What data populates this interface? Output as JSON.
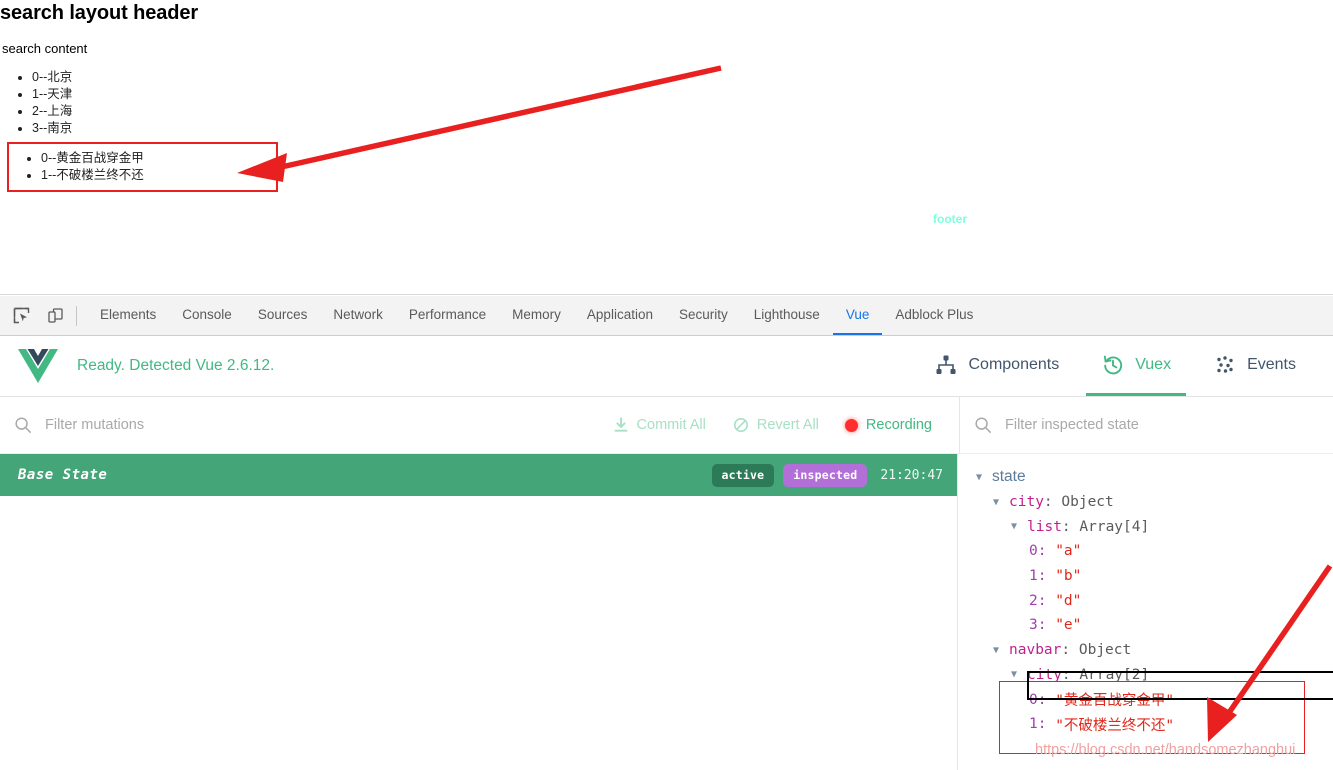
{
  "page": {
    "title": "search layout header",
    "subtitle": "search content",
    "city_list": [
      "0--北京",
      "1--天津",
      "2--上海",
      "3--南京"
    ],
    "navbar_list": [
      "0--黄金百战穿金甲",
      "1--不破楼兰终不还"
    ],
    "footer_label": "footer",
    "highlight_color": "#e8201f",
    "footer_color": "#7cffdd"
  },
  "devtools": {
    "left_icons": [
      "inspect-element-icon",
      "device-toolbar-icon"
    ],
    "tabs": [
      {
        "label": "Elements",
        "active": false
      },
      {
        "label": "Console",
        "active": false
      },
      {
        "label": "Sources",
        "active": false
      },
      {
        "label": "Network",
        "active": false
      },
      {
        "label": "Performance",
        "active": false
      },
      {
        "label": "Memory",
        "active": false
      },
      {
        "label": "Application",
        "active": false
      },
      {
        "label": "Security",
        "active": false
      },
      {
        "label": "Lighthouse",
        "active": false
      },
      {
        "label": "Vue",
        "active": true
      },
      {
        "label": "Adblock Plus",
        "active": false
      }
    ],
    "active_tab_color": "#1a73e8"
  },
  "vue_devtools": {
    "status_text": "Ready. Detected Vue 2.6.12.",
    "logo": "vue-logo-icon",
    "accent_color": "#42b883",
    "panel_tabs": [
      {
        "label": "Components",
        "icon": "components-tree-icon",
        "active": false
      },
      {
        "label": "Vuex",
        "icon": "vuex-history-icon",
        "active": true
      },
      {
        "label": "Events",
        "icon": "events-dots-icon",
        "active": false
      }
    ]
  },
  "mutations": {
    "filter_placeholder": "Filter mutations",
    "filter_value": "",
    "actions": [
      {
        "label": "Commit All",
        "icon": "download-icon",
        "enabled": false
      },
      {
        "label": "Revert All",
        "icon": "revert-circle-slash-icon",
        "enabled": false
      },
      {
        "label": "Recording",
        "icon": "record-dot-icon",
        "enabled": true
      }
    ],
    "entries": [
      {
        "label": "Base State",
        "badges": [
          "active",
          "inspected"
        ],
        "time": "21:20:47"
      }
    ]
  },
  "inspected_state": {
    "filter_placeholder": "Filter inspected state",
    "filter_value": "",
    "root_label": "state",
    "tree": {
      "city_key": "city",
      "city_type": "Object",
      "list_key": "list",
      "list_type": "Array[4]",
      "list_items": [
        {
          "index": "0:",
          "value": "\"a\""
        },
        {
          "index": "1:",
          "value": "\"b\""
        },
        {
          "index": "2:",
          "value": "\"d\""
        },
        {
          "index": "3:",
          "value": "\"e\""
        }
      ],
      "navbar_key": "navbar",
      "navbar_type": "Object",
      "navbar_city_key": "city",
      "navbar_city_type": "Array[2]",
      "navbar_city_items": [
        {
          "index": "0:",
          "value": "\"黄金百战穿金甲\""
        },
        {
          "index": "1:",
          "value": "\"不破楼兰终不还\""
        }
      ]
    }
  },
  "watermark": {
    "text": "https://blog.csdn.net/handsomezhanghui"
  }
}
